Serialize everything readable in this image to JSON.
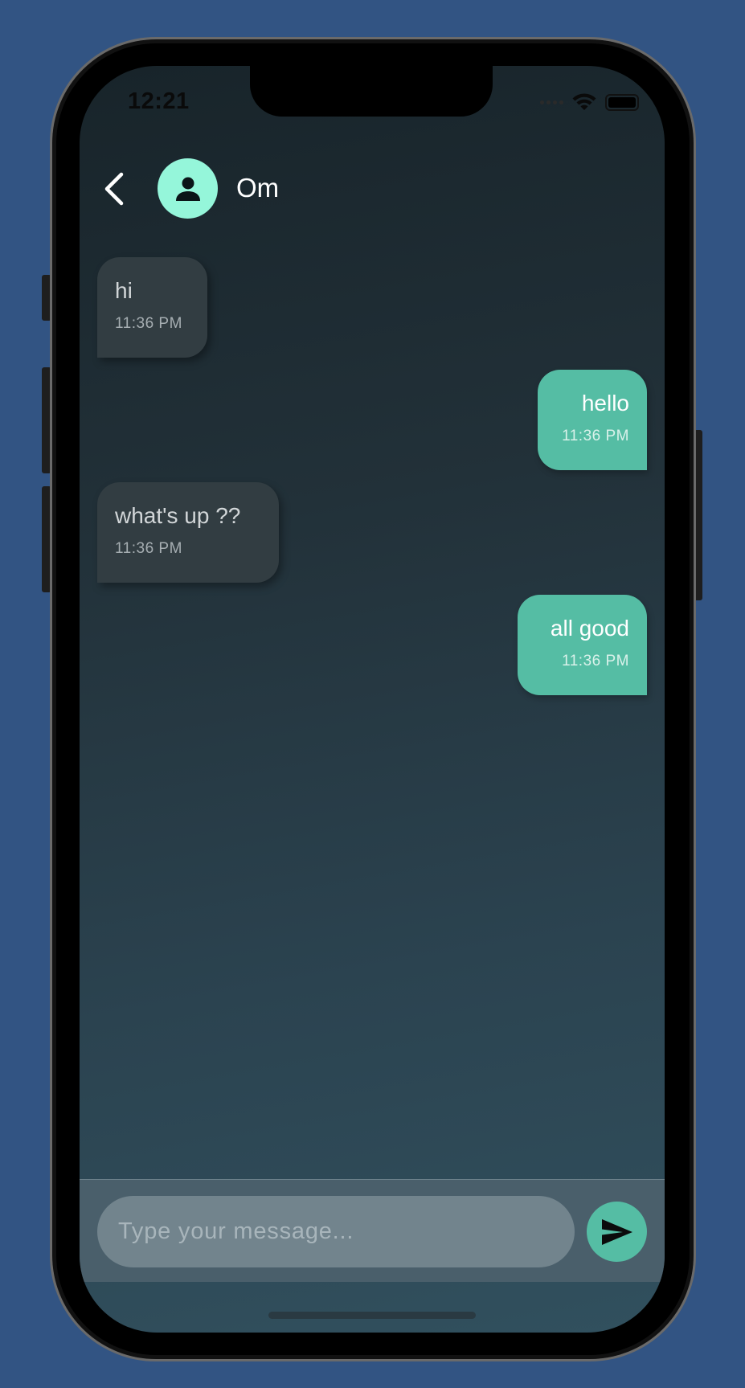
{
  "status_bar": {
    "time": "12:21"
  },
  "header": {
    "contact_name": "Om"
  },
  "messages": [
    {
      "direction": "received",
      "text": "hi",
      "time": "11:36 PM"
    },
    {
      "direction": "sent",
      "text": "hello",
      "time": "11:36 PM"
    },
    {
      "direction": "received",
      "text": "what's up ??",
      "time": "11:36 PM"
    },
    {
      "direction": "sent",
      "text": "all good",
      "time": "11:36 PM"
    }
  ],
  "composer": {
    "placeholder": "Type your message..."
  },
  "colors": {
    "background": "#325483",
    "accent": "#55bda4",
    "avatar": "#95f6da",
    "received_bubble": "#323d42"
  },
  "icons": {
    "back": "chevron-left-icon",
    "avatar": "person-icon",
    "send": "send-icon",
    "wifi": "wifi-icon",
    "battery": "battery-icon"
  }
}
